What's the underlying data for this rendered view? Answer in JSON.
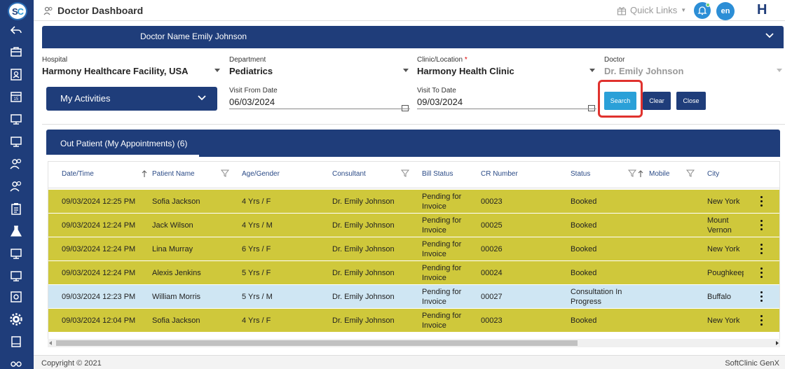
{
  "header": {
    "title": "Doctor Dashboard",
    "quick_links": "Quick Links",
    "language": "en"
  },
  "doctor_bar": {
    "name": "Doctor Name Emily Johnson"
  },
  "filters": {
    "hospital_label": "Hospital",
    "hospital_value": "Harmony Healthcare Facility, USA",
    "department_label": "Department",
    "department_value": "Pediatrics",
    "clinic_label": "Clinic/Location",
    "clinic_required": "*",
    "clinic_value": "Harmony Health Clinic",
    "doctor_label": "Doctor",
    "doctor_value": "Dr. Emily Johnson",
    "activities_label": "My Activities",
    "visit_from_label": "Visit From Date",
    "visit_from_value": "06/03/2024",
    "visit_to_label": "Visit To Date",
    "visit_to_value": "09/03/2024",
    "search_label": "Search",
    "clear_label": "Clear",
    "close_label": "Close"
  },
  "tab": {
    "label": "Out Patient (My Appointments) (6)"
  },
  "table": {
    "columns": [
      "Date/Time",
      "Patient Name",
      "Age/Gender",
      "Consultant",
      "Bill Status",
      "CR Number",
      "Status",
      "Mobile",
      "City"
    ],
    "rows": [
      {
        "datetime": "09/03/2024 12:25 PM",
        "patient": "Sofia Jackson",
        "age": "4 Yrs / F",
        "consultant": "Dr. Emily Johnson",
        "bill1": "Pending for",
        "bill2": "Invoice",
        "cr": "00023",
        "status1": "Booked",
        "status2": "",
        "mobile": "",
        "city1": "New York",
        "city2": ""
      },
      {
        "datetime": "09/03/2024 12:24 PM",
        "patient": "Jack Wilson",
        "age": "4 Yrs / M",
        "consultant": "Dr. Emily Johnson",
        "bill1": "Pending for",
        "bill2": "Invoice",
        "cr": "00025",
        "status1": "Booked",
        "status2": "",
        "mobile": "",
        "city1": "Mount",
        "city2": "Vernon"
      },
      {
        "datetime": "09/03/2024 12:24 PM",
        "patient": "Lina Murray",
        "age": "6 Yrs / F",
        "consultant": "Dr. Emily Johnson",
        "bill1": "Pending for",
        "bill2": "Invoice",
        "cr": "00026",
        "status1": "Booked",
        "status2": "",
        "mobile": "",
        "city1": "New York",
        "city2": ""
      },
      {
        "datetime": "09/03/2024 12:24 PM",
        "patient": "Alexis Jenkins",
        "age": "5 Yrs / F",
        "consultant": "Dr. Emily Johnson",
        "bill1": "Pending for",
        "bill2": "Invoice",
        "cr": "00024",
        "status1": "Booked",
        "status2": "",
        "mobile": "",
        "city1": "Poughkeep",
        "city2": ""
      },
      {
        "datetime": "09/03/2024 12:23 PM",
        "patient": "William Morris",
        "age": "5 Yrs / M",
        "consultant": "Dr. Emily Johnson",
        "bill1": "Pending for",
        "bill2": "Invoice",
        "cr": "00027",
        "status1": "Consultation In",
        "status2": "Progress",
        "mobile": "",
        "city1": "Buffalo",
        "city2": ""
      },
      {
        "datetime": "09/03/2024 12:04 PM",
        "patient": "Sofia Jackson",
        "age": "4 Yrs / F",
        "consultant": "Dr. Emily Johnson",
        "bill1": "Pending for",
        "bill2": "Invoice",
        "cr": "00023",
        "status1": "Booked",
        "status2": "",
        "mobile": "",
        "city1": "New York",
        "city2": ""
      }
    ]
  },
  "footer": {
    "copyright": "Copyright © 2021",
    "product": "SoftClinic GenX"
  },
  "colors": {
    "navy": "#1f3d7a",
    "accent": "#2aa0d8",
    "booked_row": "#cfc83b",
    "consult_row": "#cfe6f3",
    "highlight": "#e0322e"
  },
  "icons": {
    "sidebar": [
      "back-arrow-icon",
      "briefcase-icon",
      "id-card-icon",
      "calendar-icon",
      "monitor-icon",
      "monitor-icon",
      "users-icon",
      "users-icon",
      "clipboard-icon",
      "flask-icon",
      "monitor-icon",
      "monitor-icon",
      "money-icon",
      "gear-icon",
      "book-icon",
      "glasses-icon"
    ]
  }
}
